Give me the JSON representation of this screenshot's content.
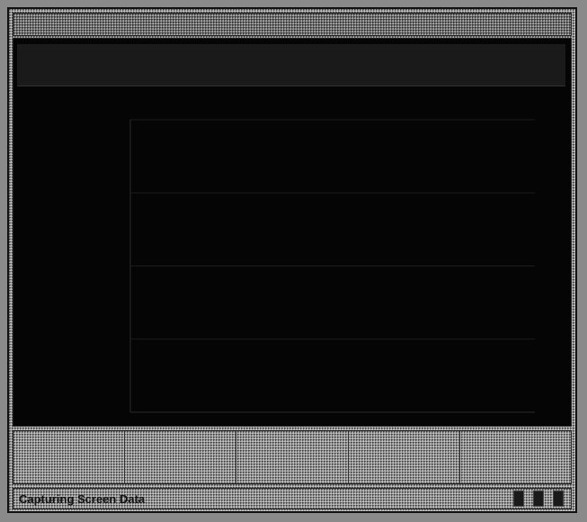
{
  "window": {
    "title_left": "",
    "title_mid": "",
    "title_right": ""
  },
  "screen_header": {
    "left_label": "",
    "right_line_1": "",
    "right_line_2": ""
  },
  "chart_data": {
    "type": "bar",
    "title": "",
    "categories": [
      "",
      "",
      "",
      "",
      ""
    ],
    "values": [
      0,
      0,
      0,
      0,
      0
    ],
    "ylim": [
      0,
      100
    ],
    "xlabel": "",
    "ylabel": "",
    "grid": true
  },
  "legend_cells": [
    {
      "label": ""
    },
    {
      "label": ""
    },
    {
      "label": ""
    },
    {
      "label": ""
    },
    {
      "label": ""
    }
  ],
  "status": {
    "text": "Capturing Screen Data"
  },
  "colors": {
    "screen_bg": "#050505",
    "bar_outline": "#3a3a3a",
    "grid": "#1c1c1c"
  }
}
